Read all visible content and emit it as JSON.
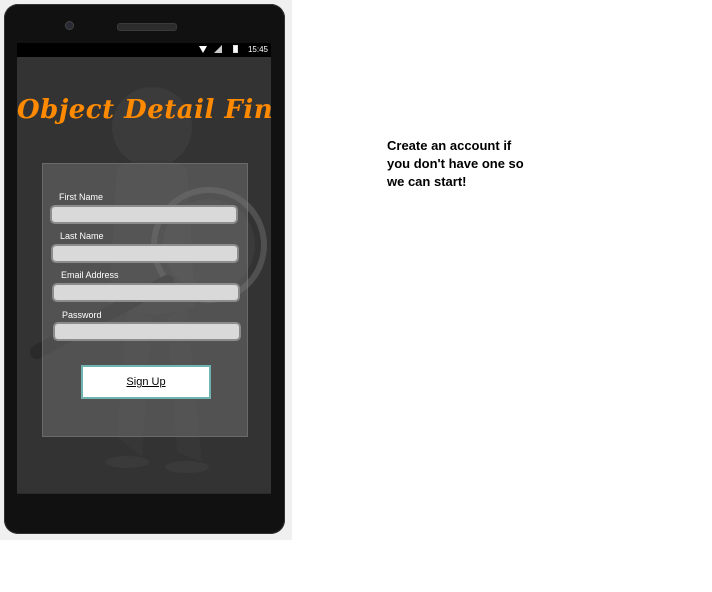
{
  "status": {
    "time": "15:45"
  },
  "app": {
    "title": "Object Detail Finder"
  },
  "form": {
    "first_name_label": "First Name",
    "last_name_label": "Last Name",
    "email_label": "Email Address",
    "password_label": "Password",
    "first_name_value": "",
    "last_name_value": "",
    "email_value": "",
    "password_value": "",
    "signup_label": "Sign Up"
  },
  "instruction": {
    "text": "Create an account if you don't have one so we can start!"
  },
  "colors": {
    "title": "#ff8a00",
    "screen_bg": "#333333",
    "input_bg": "#d9d9d9",
    "button_border": "#6fb4b0"
  },
  "icons": [
    "camera-icon",
    "speaker-icon",
    "wifi-icon",
    "signal-icon",
    "battery-icon",
    "magnifier-figure-image"
  ]
}
